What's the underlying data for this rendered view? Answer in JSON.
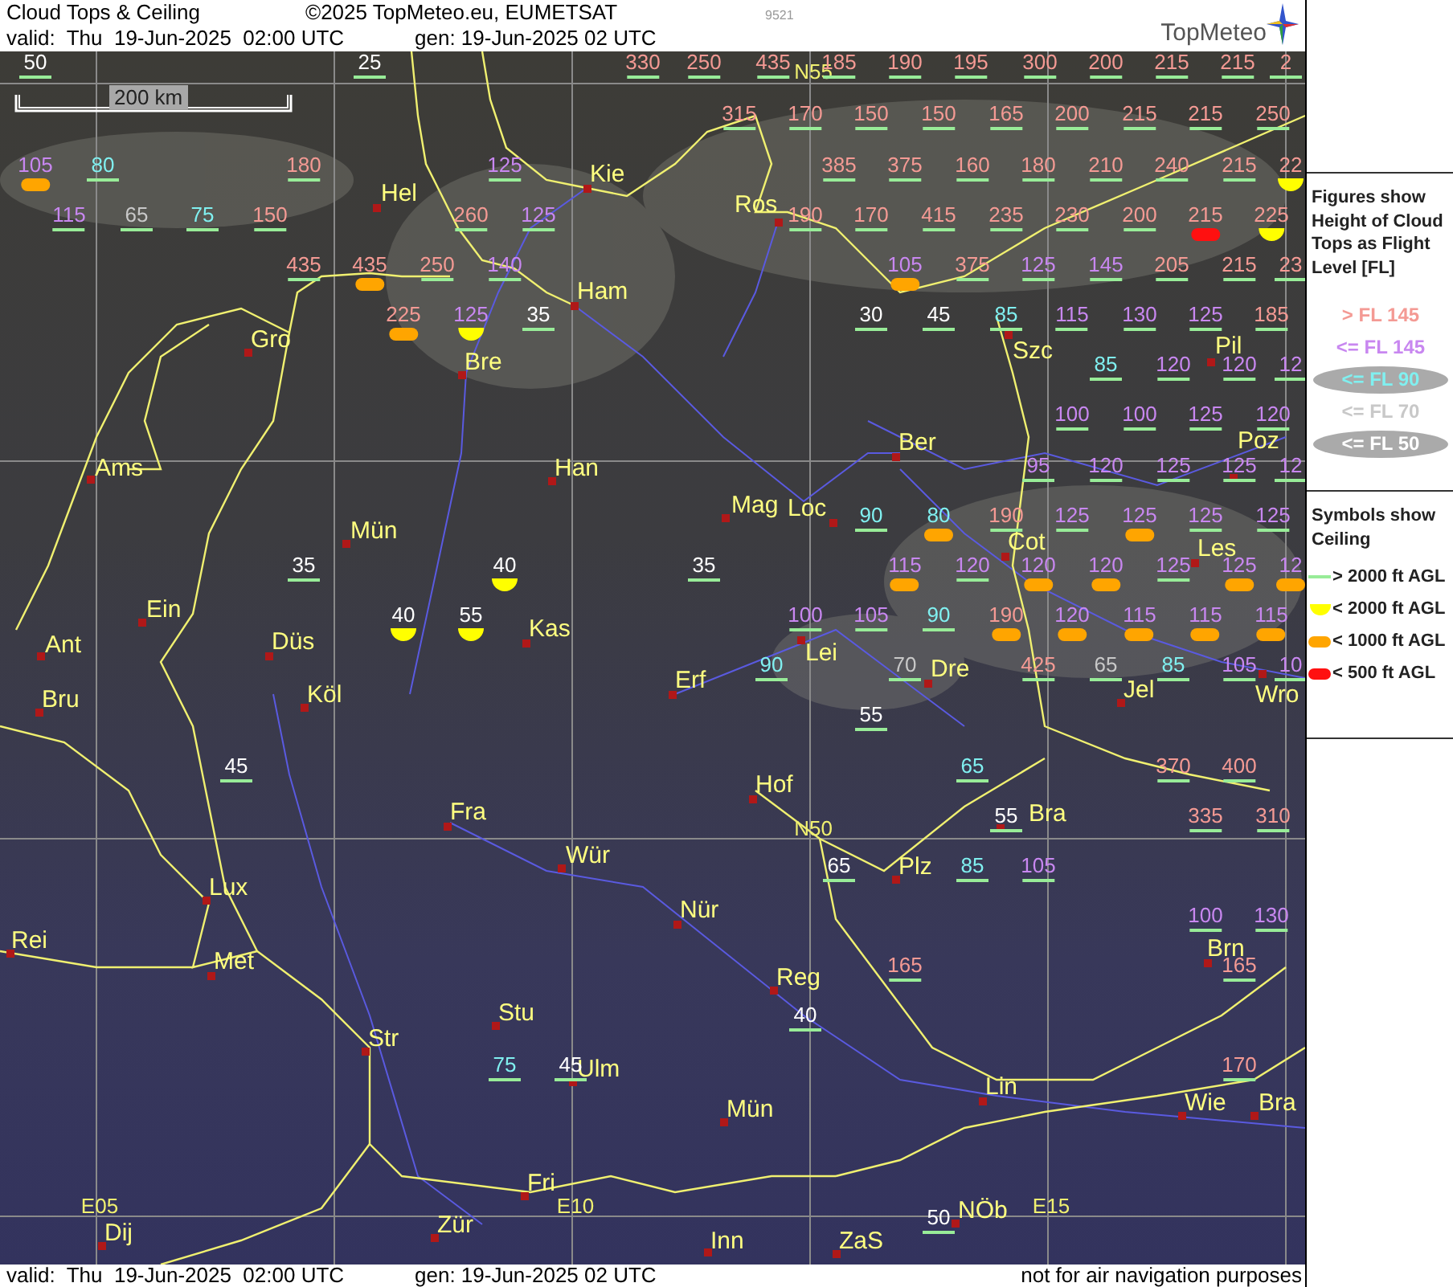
{
  "header": {
    "title": "Cloud Tops & Ceiling",
    "copyright": "©2025 TopMeteo.eu, EUMETSAT",
    "code": "9521",
    "valid": "valid:  Thu  19-Jun-2025  02:00 UTC",
    "generated": "gen: 19-Jun-2025 02 UTC",
    "logo": "TopMeteo"
  },
  "map": {
    "scale": "200 km",
    "grid_labels": [
      "N55",
      "N50",
      "E05",
      "E10",
      "E15"
    ],
    "cities": [
      {
        "name": "Hel"
      },
      {
        "name": "Kie"
      },
      {
        "name": "Ros"
      },
      {
        "name": "Ham"
      },
      {
        "name": "Gro"
      },
      {
        "name": "Bre"
      },
      {
        "name": "Szc"
      },
      {
        "name": "Pil"
      },
      {
        "name": "Ber"
      },
      {
        "name": "Ams"
      },
      {
        "name": "Han"
      },
      {
        "name": "Poz"
      },
      {
        "name": "Mag"
      },
      {
        "name": "Loc"
      },
      {
        "name": "Mün"
      },
      {
        "name": "Cot"
      },
      {
        "name": "Les"
      },
      {
        "name": "Ein"
      },
      {
        "name": "Ant"
      },
      {
        "name": "Düs"
      },
      {
        "name": "Kas"
      },
      {
        "name": "Lei"
      },
      {
        "name": "Bru"
      },
      {
        "name": "Köl"
      },
      {
        "name": "Erf"
      },
      {
        "name": "Dre"
      },
      {
        "name": "Jel"
      },
      {
        "name": "Wro"
      },
      {
        "name": "Hof"
      },
      {
        "name": "Fra"
      },
      {
        "name": "Bra"
      },
      {
        "name": "Wür"
      },
      {
        "name": "Plz"
      },
      {
        "name": "Lux"
      },
      {
        "name": "Nür"
      },
      {
        "name": "Rei"
      },
      {
        "name": "Met"
      },
      {
        "name": "Reg"
      },
      {
        "name": "Brn"
      },
      {
        "name": "Stu"
      },
      {
        "name": "Str"
      },
      {
        "name": "Ulm"
      },
      {
        "name": "Lin"
      },
      {
        "name": "Mün"
      },
      {
        "name": "Wie"
      },
      {
        "name": "Bra"
      },
      {
        "name": "Fri"
      },
      {
        "name": "NÖb"
      },
      {
        "name": "Dij"
      },
      {
        "name": "Zür"
      },
      {
        "name": "Inn"
      },
      {
        "name": "ZaS"
      }
    ],
    "labels": [
      {
        "value": "50",
        "color": "#ffffff",
        "kind": "above_2000"
      },
      {
        "value": "25",
        "color": "#ffffff",
        "kind": "above_2000"
      },
      {
        "value": "330",
        "color": "#f49a94",
        "kind": "above_2000"
      },
      {
        "value": "250",
        "color": "#f49a94",
        "kind": "above_2000"
      },
      {
        "value": "435",
        "color": "#f49a94",
        "kind": "above_2000"
      },
      {
        "value": "185",
        "color": "#f49a94",
        "kind": "above_2000"
      },
      {
        "value": "190",
        "color": "#f49a94",
        "kind": "above_2000"
      },
      {
        "value": "195",
        "color": "#f49a94",
        "kind": "above_2000"
      },
      {
        "value": "300",
        "color": "#f49a94",
        "kind": "above_2000"
      },
      {
        "value": "200",
        "color": "#f49a94",
        "kind": "above_2000"
      },
      {
        "value": "215",
        "color": "#f49a94",
        "kind": "above_2000"
      },
      {
        "value": "215",
        "color": "#f49a94",
        "kind": "above_2000"
      },
      {
        "value": "2",
        "color": "#f49a94",
        "kind": "above_2000"
      },
      {
        "value": "315",
        "color": "#f49a94",
        "kind": "above_2000"
      },
      {
        "value": "170",
        "color": "#f49a94",
        "kind": "above_2000"
      },
      {
        "value": "150",
        "color": "#f49a94",
        "kind": "above_2000"
      },
      {
        "value": "150",
        "color": "#f49a94",
        "kind": "above_2000"
      },
      {
        "value": "165",
        "color": "#f49a94",
        "kind": "above_2000"
      },
      {
        "value": "200",
        "color": "#f49a94",
        "kind": "above_2000"
      },
      {
        "value": "215",
        "color": "#f49a94",
        "kind": "above_2000"
      },
      {
        "value": "215",
        "color": "#f49a94",
        "kind": "above_2000"
      },
      {
        "value": "250",
        "color": "#f49a94",
        "kind": "above_2000"
      },
      {
        "value": "105",
        "color": "#c887f0",
        "kind": "below_1000"
      },
      {
        "value": "80",
        "color": "#80f0f0",
        "kind": "above_2000"
      },
      {
        "value": "180",
        "color": "#f49a94",
        "kind": "above_2000"
      },
      {
        "value": "125",
        "color": "#c887f0",
        "kind": "above_2000"
      },
      {
        "value": "385",
        "color": "#f49a94",
        "kind": "above_2000"
      },
      {
        "value": "375",
        "color": "#f49a94",
        "kind": "above_2000"
      },
      {
        "value": "160",
        "color": "#f49a94",
        "kind": "above_2000"
      },
      {
        "value": "180",
        "color": "#f49a94",
        "kind": "above_2000"
      },
      {
        "value": "210",
        "color": "#f49a94",
        "kind": "above_2000"
      },
      {
        "value": "240",
        "color": "#f49a94",
        "kind": "above_2000"
      },
      {
        "value": "215",
        "color": "#f49a94",
        "kind": "above_2000"
      },
      {
        "value": "22",
        "color": "#f49a94",
        "kind": "below_2000"
      },
      {
        "value": "115",
        "color": "#c887f0",
        "kind": "above_2000"
      },
      {
        "value": "65",
        "color": "#c8c8c8",
        "kind": "above_2000"
      },
      {
        "value": "75",
        "color": "#80f0f0",
        "kind": "above_2000"
      },
      {
        "value": "150",
        "color": "#f49a94",
        "kind": "above_2000"
      },
      {
        "value": "260",
        "color": "#f49a94",
        "kind": "above_2000"
      },
      {
        "value": "125",
        "color": "#c887f0",
        "kind": "above_2000"
      },
      {
        "value": "190",
        "color": "#f49a94",
        "kind": "above_2000"
      },
      {
        "value": "170",
        "color": "#f49a94",
        "kind": "above_2000"
      },
      {
        "value": "415",
        "color": "#f49a94",
        "kind": "above_2000"
      },
      {
        "value": "235",
        "color": "#f49a94",
        "kind": "above_2000"
      },
      {
        "value": "230",
        "color": "#f49a94",
        "kind": "above_2000"
      },
      {
        "value": "200",
        "color": "#f49a94",
        "kind": "above_2000"
      },
      {
        "value": "215",
        "color": "#f49a94",
        "kind": "below_500"
      },
      {
        "value": "225",
        "color": "#f49a94",
        "kind": "below_2000"
      },
      {
        "value": "435",
        "color": "#f49a94",
        "kind": "above_2000"
      },
      {
        "value": "435",
        "color": "#f49a94",
        "kind": "below_1000"
      },
      {
        "value": "250",
        "color": "#f49a94",
        "kind": "above_2000"
      },
      {
        "value": "140",
        "color": "#c887f0",
        "kind": "above_2000"
      },
      {
        "value": "105",
        "color": "#c887f0",
        "kind": "below_1000"
      },
      {
        "value": "375",
        "color": "#f49a94",
        "kind": "above_2000"
      },
      {
        "value": "125",
        "color": "#c887f0",
        "kind": "above_2000"
      },
      {
        "value": "145",
        "color": "#c887f0",
        "kind": "above_2000"
      },
      {
        "value": "205",
        "color": "#f49a94",
        "kind": "above_2000"
      },
      {
        "value": "215",
        "color": "#f49a94",
        "kind": "above_2000"
      },
      {
        "value": "23",
        "color": "#f49a94",
        "kind": "above_2000"
      },
      {
        "value": "225",
        "color": "#f49a94",
        "kind": "below_1000"
      },
      {
        "value": "125",
        "color": "#c887f0",
        "kind": "below_2000"
      },
      {
        "value": "35",
        "color": "#ffffff",
        "kind": "above_2000"
      },
      {
        "value": "30",
        "color": "#ffffff",
        "kind": "above_2000"
      },
      {
        "value": "45",
        "color": "#ffffff",
        "kind": "above_2000"
      },
      {
        "value": "85",
        "color": "#80f0f0",
        "kind": "above_2000"
      },
      {
        "value": "115",
        "color": "#c887f0",
        "kind": "above_2000"
      },
      {
        "value": "130",
        "color": "#c887f0",
        "kind": "above_2000"
      },
      {
        "value": "125",
        "color": "#c887f0",
        "kind": "above_2000"
      },
      {
        "value": "185",
        "color": "#f49a94",
        "kind": "above_2000"
      },
      {
        "value": "85",
        "color": "#80f0f0",
        "kind": "above_2000"
      },
      {
        "value": "120",
        "color": "#c887f0",
        "kind": "above_2000"
      },
      {
        "value": "120",
        "color": "#c887f0",
        "kind": "above_2000"
      },
      {
        "value": "12",
        "color": "#c887f0",
        "kind": "above_2000"
      },
      {
        "value": "100",
        "color": "#c887f0",
        "kind": "above_2000"
      },
      {
        "value": "100",
        "color": "#c887f0",
        "kind": "above_2000"
      },
      {
        "value": "125",
        "color": "#c887f0",
        "kind": "above_2000"
      },
      {
        "value": "120",
        "color": "#c887f0",
        "kind": "above_2000"
      },
      {
        "value": "95",
        "color": "#c887f0",
        "kind": "above_2000"
      },
      {
        "value": "120",
        "color": "#c887f0",
        "kind": "above_2000"
      },
      {
        "value": "125",
        "color": "#c887f0",
        "kind": "above_2000"
      },
      {
        "value": "125",
        "color": "#c887f0",
        "kind": "above_2000"
      },
      {
        "value": "12",
        "color": "#c887f0",
        "kind": "above_2000"
      },
      {
        "value": "90",
        "color": "#80f0f0",
        "kind": "above_2000"
      },
      {
        "value": "80",
        "color": "#80f0f0",
        "kind": "below_1000"
      },
      {
        "value": "190",
        "color": "#f49a94",
        "kind": "above_2000"
      },
      {
        "value": "125",
        "color": "#c887f0",
        "kind": "above_2000"
      },
      {
        "value": "125",
        "color": "#c887f0",
        "kind": "below_1000"
      },
      {
        "value": "125",
        "color": "#c887f0",
        "kind": "above_2000"
      },
      {
        "value": "125",
        "color": "#c887f0",
        "kind": "above_2000"
      },
      {
        "value": "35",
        "color": "#ffffff",
        "kind": "above_2000"
      },
      {
        "value": "40",
        "color": "#ffffff",
        "kind": "below_2000"
      },
      {
        "value": "35",
        "color": "#ffffff",
        "kind": "above_2000"
      },
      {
        "value": "115",
        "color": "#c887f0",
        "kind": "below_1000"
      },
      {
        "value": "120",
        "color": "#c887f0",
        "kind": "above_2000"
      },
      {
        "value": "120",
        "color": "#c887f0",
        "kind": "below_1000"
      },
      {
        "value": "120",
        "color": "#c887f0",
        "kind": "below_1000"
      },
      {
        "value": "125",
        "color": "#c887f0",
        "kind": "above_2000"
      },
      {
        "value": "125",
        "color": "#c887f0",
        "kind": "below_1000"
      },
      {
        "value": "12",
        "color": "#c887f0",
        "kind": "below_1000"
      },
      {
        "value": "40",
        "color": "#ffffff",
        "kind": "below_2000"
      },
      {
        "value": "55",
        "color": "#ffffff",
        "kind": "below_2000"
      },
      {
        "value": "100",
        "color": "#c887f0",
        "kind": "above_2000"
      },
      {
        "value": "105",
        "color": "#c887f0",
        "kind": "above_2000"
      },
      {
        "value": "90",
        "color": "#80f0f0",
        "kind": "above_2000"
      },
      {
        "value": "190",
        "color": "#f49a94",
        "kind": "below_1000"
      },
      {
        "value": "120",
        "color": "#c887f0",
        "kind": "below_1000"
      },
      {
        "value": "115",
        "color": "#c887f0",
        "kind": "below_1000"
      },
      {
        "value": "115",
        "color": "#c887f0",
        "kind": "below_1000"
      },
      {
        "value": "115",
        "color": "#c887f0",
        "kind": "below_1000"
      },
      {
        "value": "90",
        "color": "#80f0f0",
        "kind": "above_2000"
      },
      {
        "value": "70",
        "color": "#c8c8c8",
        "kind": "above_2000"
      },
      {
        "value": "425",
        "color": "#f49a94",
        "kind": "above_2000"
      },
      {
        "value": "65",
        "color": "#c8c8c8",
        "kind": "above_2000"
      },
      {
        "value": "85",
        "color": "#80f0f0",
        "kind": "above_2000"
      },
      {
        "value": "105",
        "color": "#c887f0",
        "kind": "above_2000"
      },
      {
        "value": "10",
        "color": "#c887f0",
        "kind": "above_2000"
      },
      {
        "value": "55",
        "color": "#ffffff",
        "kind": "above_2000"
      },
      {
        "value": "45",
        "color": "#ffffff",
        "kind": "above_2000"
      },
      {
        "value": "65",
        "color": "#80f0f0",
        "kind": "above_2000"
      },
      {
        "value": "370",
        "color": "#f49a94",
        "kind": "above_2000"
      },
      {
        "value": "400",
        "color": "#f49a94",
        "kind": "above_2000"
      },
      {
        "value": "55",
        "color": "#ffffff",
        "kind": "above_2000"
      },
      {
        "value": "335",
        "color": "#f49a94",
        "kind": "above_2000"
      },
      {
        "value": "310",
        "color": "#f49a94",
        "kind": "above_2000"
      },
      {
        "value": "65",
        "color": "#ffffff",
        "kind": "above_2000"
      },
      {
        "value": "85",
        "color": "#80f0f0",
        "kind": "above_2000"
      },
      {
        "value": "105",
        "color": "#c887f0",
        "kind": "above_2000"
      },
      {
        "value": "100",
        "color": "#c887f0",
        "kind": "above_2000"
      },
      {
        "value": "130",
        "color": "#c887f0",
        "kind": "above_2000"
      },
      {
        "value": "165",
        "color": "#f49a94",
        "kind": "above_2000"
      },
      {
        "value": "165",
        "color": "#f49a94",
        "kind": "above_2000"
      },
      {
        "value": "40",
        "color": "#ffffff",
        "kind": "above_2000"
      },
      {
        "value": "75",
        "color": "#80f0f0",
        "kind": "above_2000"
      },
      {
        "value": "45",
        "color": "#ffffff",
        "kind": "above_2000"
      },
      {
        "value": "170",
        "color": "#f49a94",
        "kind": "above_2000"
      },
      {
        "value": "50",
        "color": "#ffffff",
        "kind": "above_2000"
      }
    ]
  },
  "legend": {
    "tops_title": "Figures show Height of Cloud Tops as Flight Level  [FL]",
    "tops": [
      {
        "label": "> FL 145",
        "color": "#f49a94",
        "kind": "plain"
      },
      {
        "label": "<= FL 145",
        "color": "#c887f0",
        "kind": "plain"
      },
      {
        "label": "<= FL 90",
        "color": "#80f0f0",
        "kind": "oval"
      },
      {
        "label": "<= FL 70",
        "color": "#c8c8c8",
        "kind": "plain"
      },
      {
        "label": "<= FL 50",
        "color": "#ffffff",
        "kind": "oval"
      }
    ],
    "ceiling_title": "Symbols show Ceiling",
    "ceilings": [
      {
        "label": "> 2000 ft AGL",
        "kind": "above_2000"
      },
      {
        "label": "< 2000 ft AGL",
        "kind": "below_2000"
      },
      {
        "label": "< 1000 ft AGL",
        "kind": "below_1000"
      },
      {
        "label": "< 500 ft AGL",
        "kind": "below_500"
      }
    ]
  },
  "footer": {
    "valid": "valid:  Thu  19-Jun-2025  02:00 UTC",
    "generated": "gen: 19-Jun-2025 02 UTC",
    "notice": "not for air navigation purposes"
  }
}
